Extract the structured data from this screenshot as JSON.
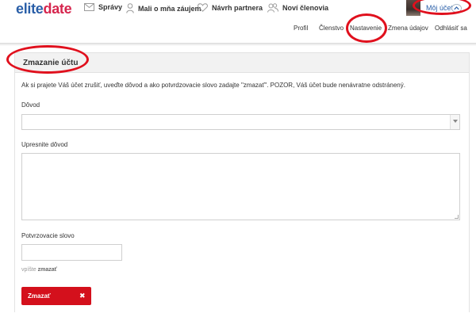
{
  "header": {
    "logo_part1": "elite",
    "logo_part2": "date",
    "nav": [
      {
        "label": "Správy",
        "icon": "envelope-icon"
      },
      {
        "label": "Mali o mňa záujem",
        "icon": "person-icon"
      },
      {
        "label": "Návrh partnera",
        "icon": "heart-icon"
      },
      {
        "label": "Noví členovia",
        "icon": "users-icon"
      }
    ],
    "account": {
      "label": "Môj účet",
      "icon": "chevron-up-icon"
    },
    "subnav": [
      "Profil",
      "Členstvo",
      "Nastavenie",
      "Zmena údajov",
      "Odhlásiť sa"
    ]
  },
  "panel": {
    "title": "Zmazanie účtu",
    "intro": "Ak si prajete Váš účet zrušiť, uveďte dôvod a ako potvrdzovacie slovo zadajte \"zmazať\". POZOR, Váš účet bude nenávratne odstránený.",
    "reason_label": "Dôvod",
    "reason_value": "",
    "details_label": "Upresnite dôvod",
    "details_value": "",
    "confirm_label": "Potvrzovacie slovo",
    "confirm_value": "",
    "hint_prefix": "vpíšte",
    "hint_word": "zmazať",
    "delete_label": "Zmazať",
    "delete_icon": "✖"
  },
  "colors": {
    "brand_blue": "#2a5fa8",
    "brand_pink": "#d6264e",
    "danger": "#d4101c",
    "annotation": "#e0101d"
  }
}
